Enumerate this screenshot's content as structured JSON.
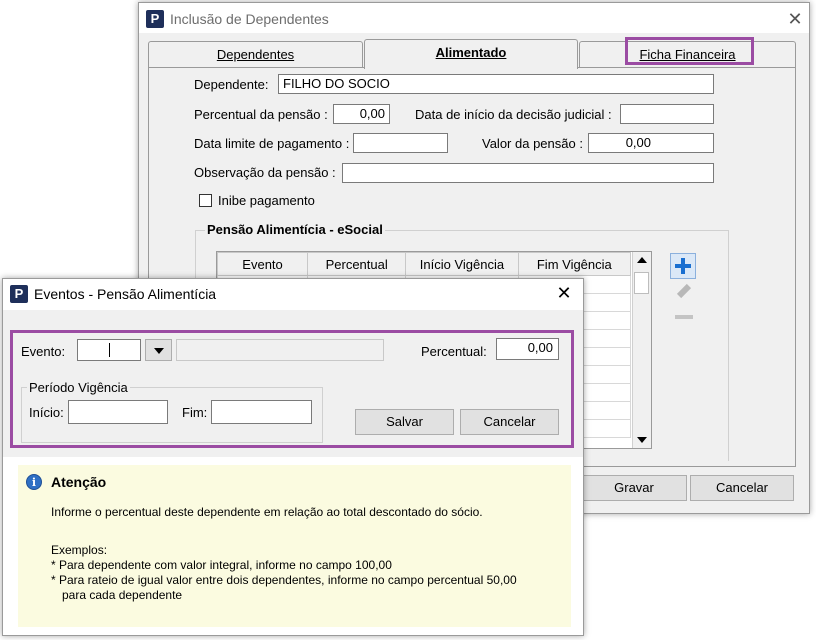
{
  "dependentes_window": {
    "title": "Inclusão de Dependentes",
    "tabs": [
      "Dependentes",
      "Alimentado",
      "Ficha Financeira"
    ],
    "dependente_label": "Dependente:",
    "dependente_value": "FILHO DO SOCIO",
    "percentual_label": "Percentual da pensão :",
    "percentual_value": "0,00",
    "data_inicio_label": "Data de início da decisão judicial :",
    "data_inicio_value": "",
    "data_limite_label": "Data limite de pagamento :",
    "data_limite_value": "",
    "valor_label": "Valor da pensão :",
    "valor_value": "0,00",
    "observacao_label": "Observação da pensão :",
    "observacao_value": "",
    "inibe_label": "Inibe pagamento",
    "group_title": "Pensão Alimentícia - eSocial",
    "grid_columns": [
      "Evento",
      "Percentual",
      "Início Vigência",
      "Fim Vigência"
    ],
    "gravar_label": "Gravar",
    "cancelar_label": "Cancelar"
  },
  "eventos_window": {
    "title": "Eventos - Pensão Alimentícia",
    "evento_label": "Evento:",
    "evento_value": "",
    "evento_description": "",
    "percentual_label": "Percentual:",
    "percentual_value": "0,00",
    "periodo_label": "Período Vigência",
    "inicio_label": "Início:",
    "inicio_value": "",
    "fim_label": "Fim:",
    "fim_value": "",
    "salvar_label": "Salvar",
    "cancelar_label": "Cancelar",
    "attention_title": "Atenção",
    "attention_text": "Informe o percentual deste dependente em relação ao total descontado do sócio.",
    "exemplos_label": "Exemplos:",
    "exemplo_1": "* Para dependente com valor integral, informe no campo 100,00",
    "exemplo_2": "* Para rateio de igual valor entre dois dependentes, informe no campo percentual 50,00",
    "exemplo_2_cont": "para cada dependente"
  },
  "colors": {
    "highlight": "#9b4ca3",
    "info_panel": "#fbfbe0",
    "app_icon": "#1e2f5a",
    "add_icon": "#1a6fd0"
  }
}
